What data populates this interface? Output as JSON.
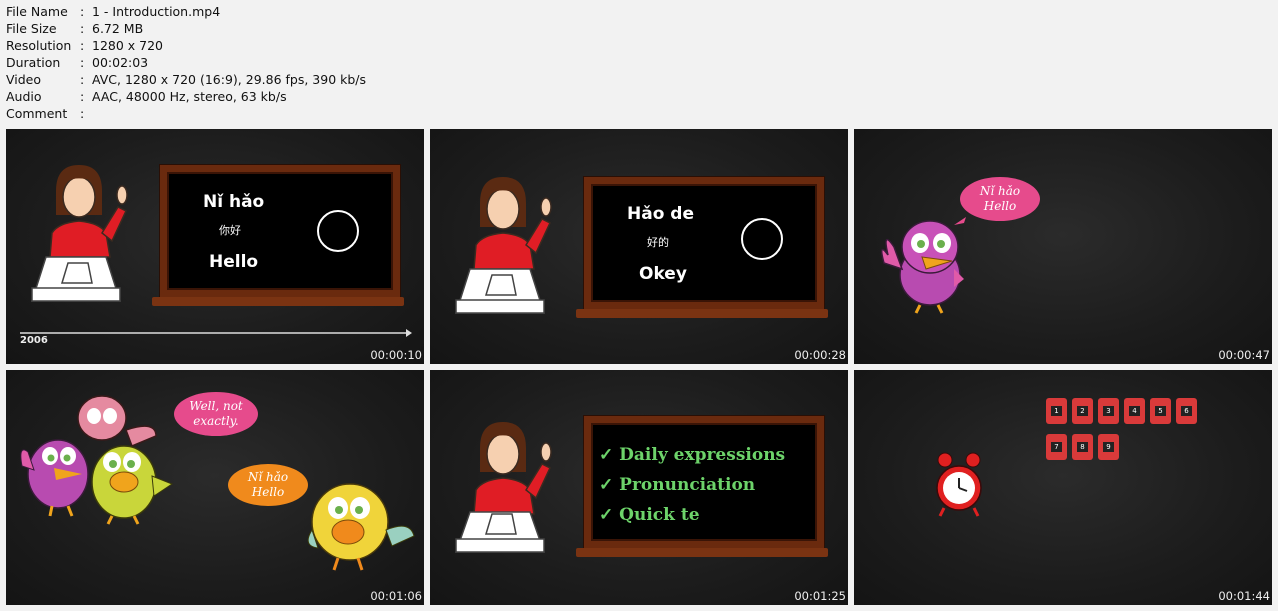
{
  "info": {
    "rows": [
      {
        "key": "File Name",
        "sep": ":",
        "value": "1 - Introduction.mp4"
      },
      {
        "key": "File Size",
        "sep": ":",
        "value": "6.72 MB"
      },
      {
        "key": "Resolution",
        "sep": ":",
        "value": "1280 x 720"
      },
      {
        "key": "Duration",
        "sep": ":",
        "value": "00:02:03"
      },
      {
        "key": "Video",
        "sep": ":",
        "value": "AVC, 1280 x 720 (16:9), 29.86 fps, 390 kb/s"
      },
      {
        "key": "Audio",
        "sep": ":",
        "value": "AAC, 48000 Hz, stereo, 63 kb/s"
      },
      {
        "key": "Comment",
        "sep": ":",
        "value": ""
      }
    ]
  },
  "thumbs": [
    {
      "timestamp": "00:00:10",
      "board_line1": "Nǐ hǎo",
      "board_chinese": "你好",
      "board_line2": "Hello",
      "timeline_label": "2006"
    },
    {
      "timestamp": "00:00:28",
      "board_line1": "Hǎo de",
      "board_chinese": "好的",
      "board_line2": "Okey"
    },
    {
      "timestamp": "00:00:47",
      "bubble_line1": "Nǐ hǎo",
      "bubble_line2": "Hello",
      "bubble_color": "#e64b8c"
    },
    {
      "timestamp": "00:01:06",
      "bubble1_line1": "Well, not",
      "bubble1_line2": "exactly.",
      "bubble1_color": "#e64b8c",
      "bubble2_line1": "Nǐ hǎo",
      "bubble2_line2": "Hello",
      "bubble2_color": "#f08a1c"
    },
    {
      "timestamp": "00:01:25",
      "lines": [
        "Daily expressions",
        "Pronunciation",
        "Quick te"
      ]
    },
    {
      "timestamp": "00:01:44",
      "calendar_numbers": [
        "1",
        "2",
        "3",
        "4",
        "5",
        "6",
        "7",
        "8",
        "9"
      ]
    }
  ]
}
